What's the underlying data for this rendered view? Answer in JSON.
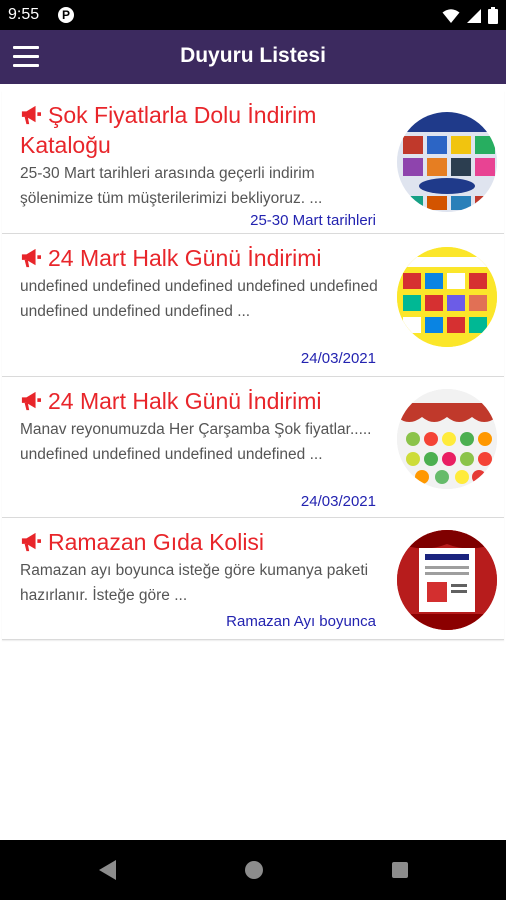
{
  "status_bar": {
    "time": "9:55",
    "app_badge": "P"
  },
  "app_bar": {
    "title": "Duyuru Listesi"
  },
  "announcements": [
    {
      "title": "Şok Fiyatlarla Dolu İndirim Kataloğu",
      "body": "25-30 Mart tarihleri arasında geçerli indirim şölenimize tüm müşterilerimizi bekliyoruz. ...",
      "date": "25-30 Mart tarihleri"
    },
    {
      "title": "24 Mart Halk Günü İndirimi",
      "body": "undefined undefined undefined undefined undefined undefined undefined undefined ...",
      "date": "24/03/2021"
    },
    {
      "title": "24 Mart Halk Günü İndirimi",
      "body": "Manav reyonumuzda Her Çarşamba Şok fiyatlar..... undefined undefined undefined undefined ...",
      "date": "24/03/2021"
    },
    {
      "title": "Ramazan Gıda Kolisi",
      "body": "Ramazan ayı boyunca isteğe göre kumanya paketi hazırlanır. İsteğe göre ...",
      "date": "Ramazan Ayı boyunca"
    }
  ],
  "colors": {
    "app_bar": "#3c2a5f",
    "title": "#e8252a",
    "date": "#2323b0",
    "body": "#555555"
  },
  "icons": {
    "menu": "hamburger-icon",
    "announce": "megaphone-icon",
    "nav_back": "back-triangle-icon",
    "nav_home": "home-circle-icon",
    "nav_recents": "recents-square-icon"
  }
}
